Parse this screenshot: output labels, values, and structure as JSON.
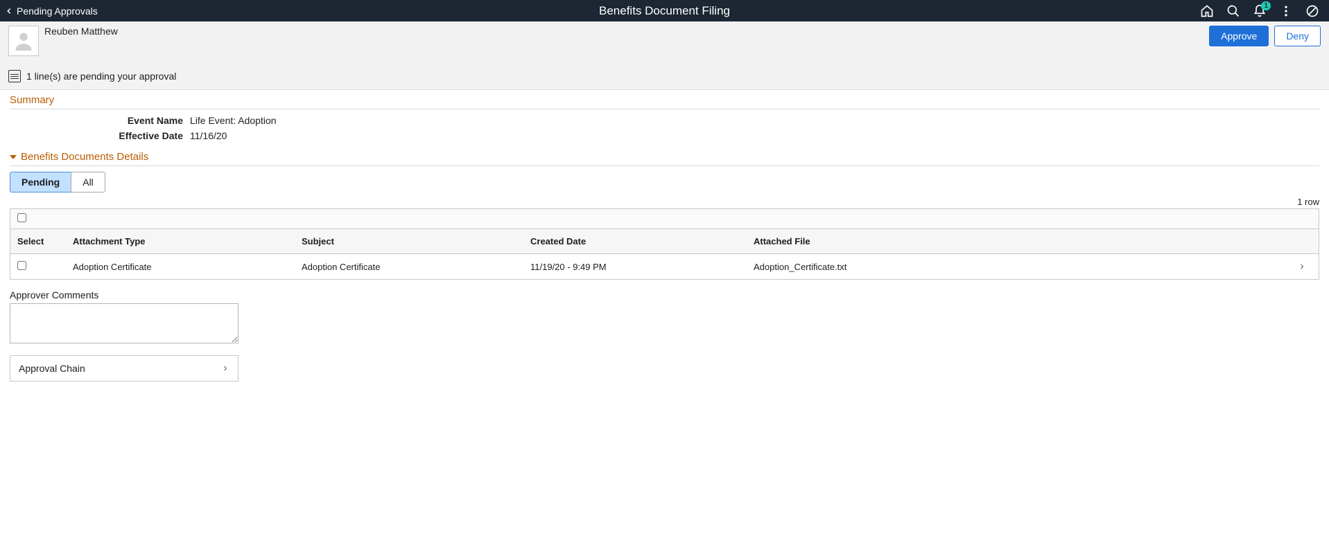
{
  "banner": {
    "back_label": "Pending Approvals",
    "title": "Benefits Document Filing",
    "notification_count": "1"
  },
  "person": {
    "name": "Reuben Matthew"
  },
  "actions": {
    "approve": "Approve",
    "deny": "Deny"
  },
  "pending_notice": "1 line(s) are pending your approval",
  "summary": {
    "title": "Summary",
    "event_name_label": "Event Name",
    "event_name_value": "Life Event: Adoption",
    "effective_date_label": "Effective Date",
    "effective_date_value": "11/16/20"
  },
  "details": {
    "title": "Benefits Documents Details",
    "tabs": {
      "pending": "Pending",
      "all": "All"
    },
    "row_count": "1 row"
  },
  "grid": {
    "headers": {
      "select": "Select",
      "type": "Attachment Type",
      "subject": "Subject",
      "created": "Created Date",
      "file": "Attached File"
    },
    "rows": [
      {
        "type": "Adoption Certificate",
        "subject": "Adoption Certificate",
        "created": "11/19/20 - 9:49 PM",
        "file": "Adoption_Certificate.txt"
      }
    ]
  },
  "comments": {
    "label": "Approver Comments",
    "value": ""
  },
  "approval_chain": {
    "label": "Approval Chain"
  }
}
